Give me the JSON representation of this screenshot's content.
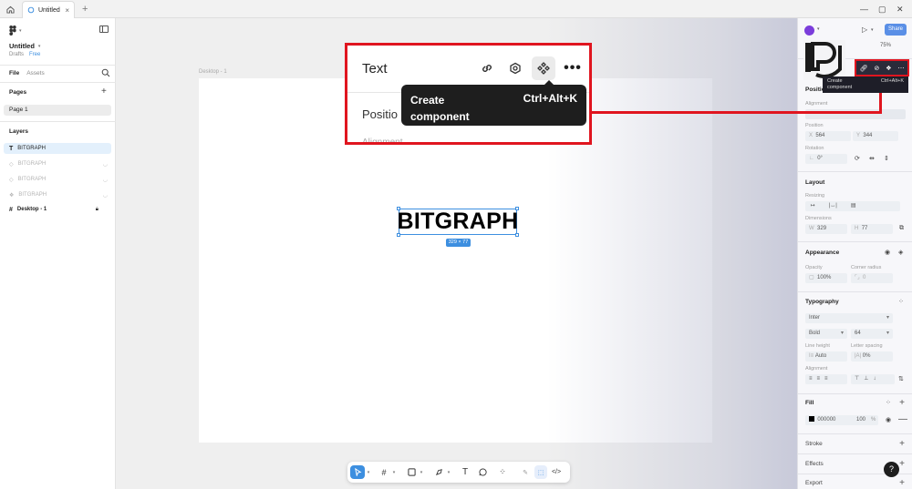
{
  "tab": {
    "title": "Untitled",
    "close": "×",
    "new": "+"
  },
  "file": {
    "name": "Untitled",
    "location": "Drafts",
    "plan": "Free"
  },
  "left_tabs": {
    "file": "File",
    "assets": "Assets"
  },
  "pages": {
    "heading": "Pages",
    "items": [
      "Page 1"
    ]
  },
  "layers": {
    "heading": "Layers",
    "items": [
      {
        "name": "BITGRAPH",
        "icon": "text-icon",
        "selected": true
      },
      {
        "name": "BITGRAPH",
        "icon": "component-icon",
        "hidden": true
      },
      {
        "name": "BITGRAPH",
        "icon": "component-icon",
        "hidden": true
      },
      {
        "name": "BITGRAPH",
        "icon": "component-icon",
        "hidden": true
      },
      {
        "name": "Desktop - 1",
        "icon": "frame-icon",
        "locked": true
      }
    ]
  },
  "canvas": {
    "frame_label": "Desktop - 1",
    "text": "BITGRAPH",
    "dimensions": "329 × 77"
  },
  "callout": {
    "title": "Text",
    "tooltip_action": "Create\ncomponent",
    "tooltip_shortcut": "Ctrl+Alt+K",
    "section": "Positio",
    "next_section": "Alignment"
  },
  "header": {
    "share": "Share",
    "zoom": "75%"
  },
  "rt_tooltip": {
    "action": "Create\ncomponent",
    "shortcut": "Ctrl+Alt+K"
  },
  "right": {
    "position": "Position",
    "alignment": "Alignment",
    "position_lbl": "Position",
    "x": "564",
    "y": "344",
    "rotation_lbl": "Rotation",
    "rotation": "0°",
    "layout": "Layout",
    "resizing": "Resizing",
    "dimensions_lbl": "Dimensions",
    "w": "329",
    "h": "77",
    "appearance": "Appearance",
    "opacity_lbl": "Opacity",
    "corner_lbl": "Corner radius",
    "opacity": "100%",
    "corner": "0",
    "typography": "Typography",
    "font": "Inter",
    "weight": "Bold",
    "size": "64",
    "line_height_lbl": "Line height",
    "letter_spacing_lbl": "Letter spacing",
    "line_height": "Auto",
    "letter_spacing": "0%",
    "align_lbl": "Alignment",
    "fill": "Fill",
    "fill_hex": "000000",
    "fill_opacity": "100",
    "fill_pct": "%",
    "stroke": "Stroke",
    "effects": "Effects",
    "export": "Export"
  },
  "help": "?",
  "colors": {
    "accent": "#3d8fe0",
    "highlight": "#e0151f",
    "tooltip": "#1e1e1e"
  }
}
